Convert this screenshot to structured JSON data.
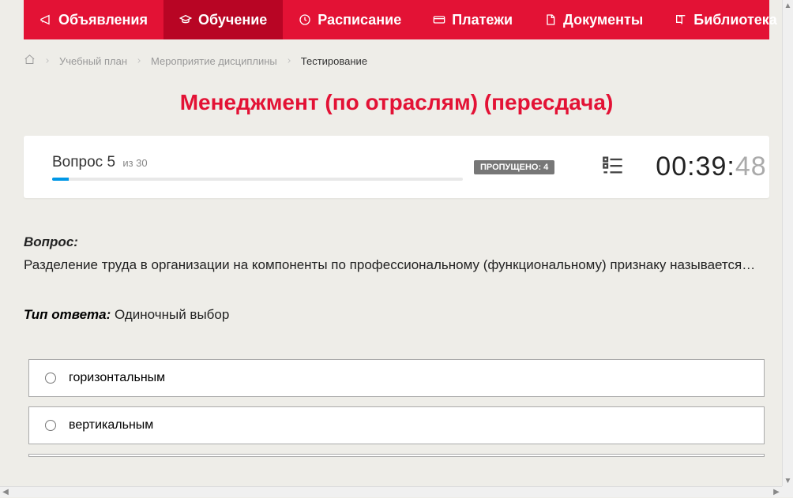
{
  "nav": {
    "items": [
      {
        "label": "Объявления",
        "icon": "announce"
      },
      {
        "label": "Обучение",
        "icon": "edu",
        "active": true
      },
      {
        "label": "Расписание",
        "icon": "schedule"
      },
      {
        "label": "Платежи",
        "icon": "payments"
      },
      {
        "label": "Документы",
        "icon": "docs"
      },
      {
        "label": "Библиотека",
        "icon": "library",
        "dropdown": true
      }
    ]
  },
  "breadcrumb": {
    "items": [
      {
        "label": "Учебный план"
      },
      {
        "label": "Мероприятие дисциплины"
      }
    ],
    "current": "Тестирование"
  },
  "title": "Менеджмент (по отраслям) (пересдача)",
  "status": {
    "question_prefix": "Вопрос",
    "question_num": "5",
    "of_word": "из",
    "total": "30",
    "skipped_label": "ПРОПУЩЕНО: 4",
    "timer_main": "00:39:",
    "timer_sec": "48"
  },
  "question": {
    "heading": "Вопрос:",
    "text": "Разделение труда в организации на компоненты по профессиональному (функциональному) признаку называется…",
    "answer_type_label": "Тип ответа:",
    "answer_type_value": "Одиночный выбор"
  },
  "answers": [
    {
      "label": "горизонтальным"
    },
    {
      "label": "вертикальным"
    }
  ]
}
